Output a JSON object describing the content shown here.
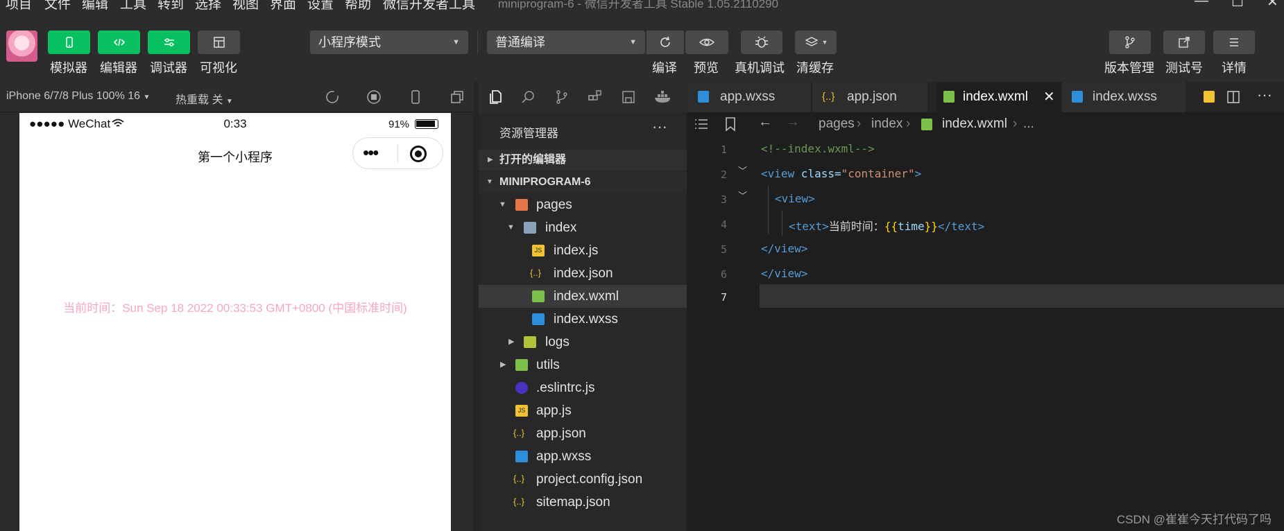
{
  "menubar": {
    "items": [
      "项目",
      "文件",
      "编辑",
      "工具",
      "转到",
      "选择",
      "视图",
      "界面",
      "设置",
      "帮助",
      "微信开发者工具"
    ],
    "window_title": "miniprogram-6 - 微信开发者工具 Stable 1.05.2110290"
  },
  "toolbar": {
    "simulator": "模拟器",
    "editor": "编辑器",
    "debugger": "调试器",
    "visual": "可视化",
    "mode_select": "小程序模式",
    "compile_select": "普通编译",
    "compile": "编译",
    "preview": "预览",
    "real_debug": "真机调试",
    "clear_cache": "清缓存",
    "version": "版本管理",
    "test_account": "测试号",
    "details": "详情",
    "accent_color": "#07c160"
  },
  "simulator": {
    "device": "iPhone 6/7/8 Plus 100% 16",
    "hot_reload": "热重载 关",
    "status_carrier": "●●●●● WeChat",
    "status_time": "0:33",
    "status_battery": "91%",
    "nav_title": "第一个小程序",
    "content_text": "当前时间：Sun Sep 18 2022 00:33:53 GMT+0800 (中国标准时间)"
  },
  "explorer": {
    "header": "资源管理器",
    "open_editors": "打开的编辑器",
    "project": "MINIPROGRAM-6",
    "tree": [
      {
        "label": "pages",
        "icon": "folder-icon"
      },
      {
        "label": "index",
        "icon": "folder-open-icon"
      },
      {
        "label": "index.js",
        "icon": "js-file-icon"
      },
      {
        "label": "index.json",
        "icon": "json-file-icon"
      },
      {
        "label": "index.wxml",
        "icon": "wxml-file-icon"
      },
      {
        "label": "index.wxss",
        "icon": "wxss-file-icon"
      },
      {
        "label": "logs",
        "icon": "folder-icon"
      },
      {
        "label": "utils",
        "icon": "folder-icon"
      },
      {
        "label": ".eslintrc.js",
        "icon": "eslint-file-icon"
      },
      {
        "label": "app.js",
        "icon": "js-file-icon"
      },
      {
        "label": "app.json",
        "icon": "json-file-icon"
      },
      {
        "label": "app.wxss",
        "icon": "wxss-file-icon"
      },
      {
        "label": "project.config.json",
        "icon": "json-file-icon"
      },
      {
        "label": "sitemap.json",
        "icon": "json-file-icon"
      }
    ]
  },
  "editor": {
    "tabs": [
      "app.wxss",
      "app.json",
      "index.wxml",
      "index.wxss"
    ],
    "active_tab": "index.wxml",
    "breadcrumb": [
      "pages",
      "index",
      "index.wxml",
      "..."
    ],
    "line_numbers": [
      "1",
      "2",
      "3",
      "4",
      "5",
      "6",
      "7"
    ],
    "code": {
      "l1": "<!--index.wxml-->",
      "l2_open": "<view",
      "l2_attr": " class=",
      "l2_str": "\"container\"",
      "l2_close": ">",
      "l3": "<view>",
      "l4_open": "<text>",
      "l4_text": "当前时间：",
      "l4_b1": "{{",
      "l4_var": "time",
      "l4_b2": "}}",
      "l4_close": "</text>",
      "l5": "</view>",
      "l6": "</view>"
    }
  },
  "watermark": "CSDN @崔崔今天打代码了吗"
}
